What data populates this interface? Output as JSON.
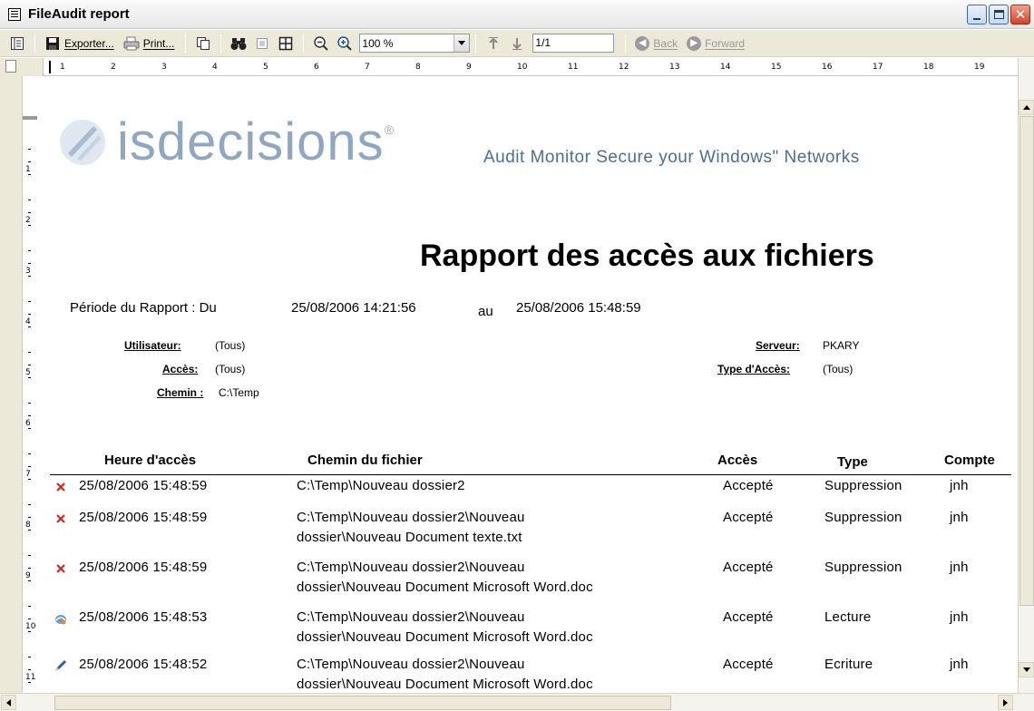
{
  "window": {
    "title": "FileAudit report"
  },
  "toolbar": {
    "export_label": "Exporter...",
    "print_label": "Print...",
    "zoom_value": "100 %",
    "page_value": "1/1",
    "back_label": "Back",
    "forward_label": "Forward"
  },
  "ruler": {
    "h_marks": [
      "1",
      "2",
      "3",
      "4",
      "5",
      "6",
      "7",
      "8",
      "9",
      "10",
      "11",
      "12",
      "13",
      "14",
      "15",
      "16",
      "17",
      "18",
      "19"
    ],
    "v_marks": [
      "1",
      "2",
      "3",
      "4",
      "5",
      "6",
      "7",
      "8",
      "9",
      "10",
      "11"
    ]
  },
  "report": {
    "logo_text": "isdecisions",
    "logo_reg": "®",
    "tagline": "Audit  Monitor  Secure  your Windows\" Networks",
    "title": "Rapport des accès aux fichiers",
    "period_label": "Période du Rapport : Du",
    "period_from": "25/08/2006 14:21:56",
    "period_to_label": "au",
    "period_to": "25/08/2006 15:48:59",
    "filters": {
      "user_label": "Utilisateur:",
      "user_value": "(Tous)",
      "access_label": "Accès:",
      "access_value": "(Tous)",
      "path_label": "Chemin :",
      "path_value": "C:\\Temp",
      "server_label": "Serveur:",
      "server_value": "PKARY",
      "access_type_label": "Type d'Accès:",
      "access_type_value": "(Tous)"
    },
    "columns": {
      "time": "Heure d'accès",
      "path": "Chemin du fichier",
      "access": "Accès",
      "type": "Type",
      "account": "Compte"
    },
    "rows": [
      {
        "icon": "delete-icon",
        "time": "25/08/2006 15:48:59",
        "path1": "C:\\Temp\\Nouveau dossier2",
        "path2": "",
        "access": "Accepté",
        "type": "Suppression",
        "account": "jnh"
      },
      {
        "icon": "delete-icon",
        "time": "25/08/2006 15:48:59",
        "path1": "C:\\Temp\\Nouveau dossier2\\Nouveau",
        "path2": "dossier\\Nouveau Document texte.txt",
        "access": "Accepté",
        "type": "Suppression",
        "account": "jnh"
      },
      {
        "icon": "delete-icon",
        "time": "25/08/2006 15:48:59",
        "path1": "C:\\Temp\\Nouveau dossier2\\Nouveau",
        "path2": "dossier\\Nouveau Document Microsoft Word.doc",
        "access": "Accepté",
        "type": "Suppression",
        "account": "jnh"
      },
      {
        "icon": "read-icon",
        "time": "25/08/2006 15:48:53",
        "path1": "C:\\Temp\\Nouveau dossier2\\Nouveau",
        "path2": "dossier\\Nouveau Document Microsoft Word.doc",
        "access": "Accepté",
        "type": "Lecture",
        "account": "jnh"
      },
      {
        "icon": "write-icon",
        "time": "25/08/2006 15:48:52",
        "path1": "C:\\Temp\\Nouveau dossier2\\Nouveau",
        "path2": "dossier\\Nouveau Document Microsoft Word.doc",
        "access": "Accepté",
        "type": "Ecriture",
        "account": "jnh"
      }
    ]
  },
  "colors": {
    "logo": "#8fa7c2",
    "tagline": "#4d6e96",
    "delete_icon": "#d9261c",
    "write_icon": "#2a5fa8"
  }
}
